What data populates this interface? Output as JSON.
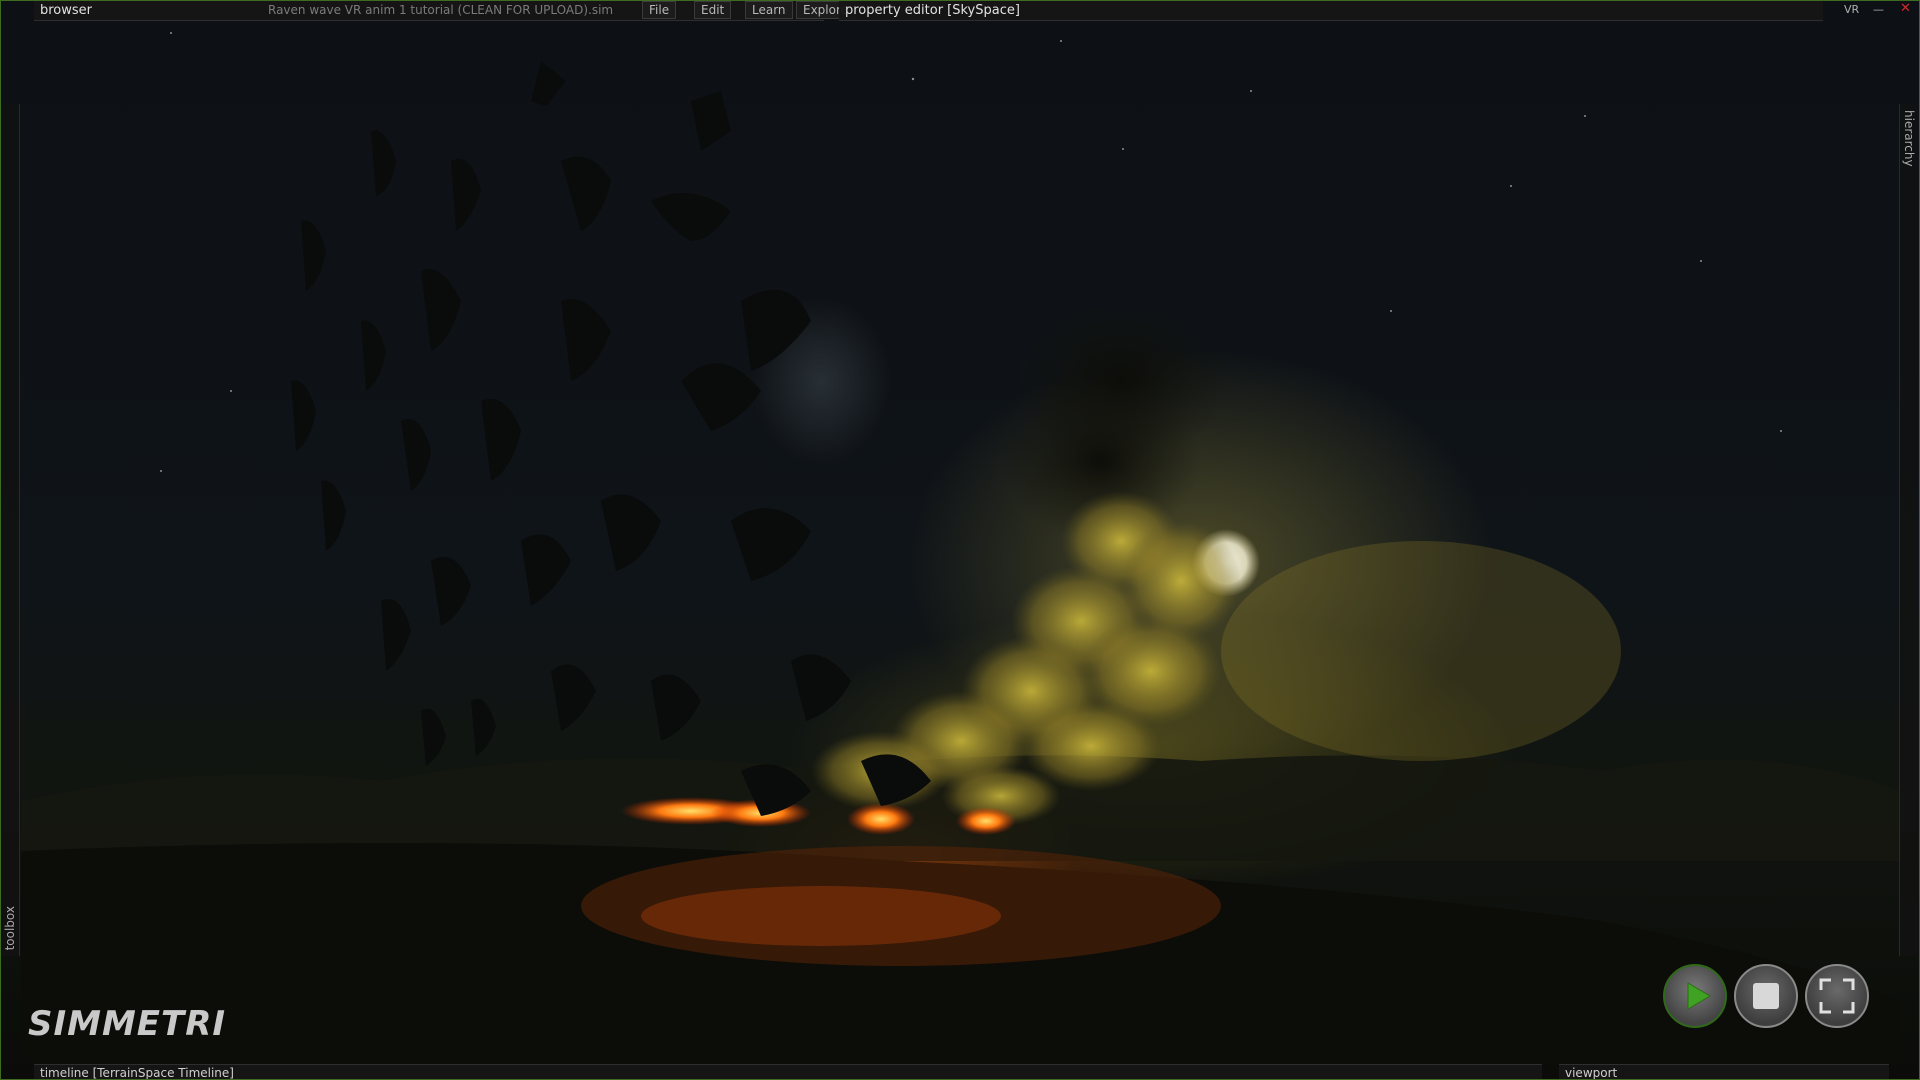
{
  "topbar": {
    "browser_label": "browser",
    "file_name": "Raven wave VR anim 1 tutorial (CLEAN FOR UPLOAD).sim",
    "menu": [
      "File",
      "Edit",
      "Learn",
      "Explore"
    ],
    "property_editor_label": "property editor [SkySpace]",
    "vr_label": "VR",
    "minimize_glyph": "—",
    "close_glyph": "✕"
  },
  "side_tabs": {
    "left": "toolbox",
    "right": "hierarchy"
  },
  "logo_text": "SIMMETRI",
  "controls": {
    "play_icon": "play-icon",
    "stop_icon": "stop-icon",
    "fullscreen_icon": "fullscreen-icon",
    "accent": "#2e6a1a"
  },
  "bottom": {
    "timeline_label": "timeline [TerrainSpace Timeline]",
    "viewport_label": "viewport"
  },
  "colors": {
    "frame_border": "#3d6b1f",
    "fire": "#ff7a10",
    "smoke": "#a69a3a"
  }
}
